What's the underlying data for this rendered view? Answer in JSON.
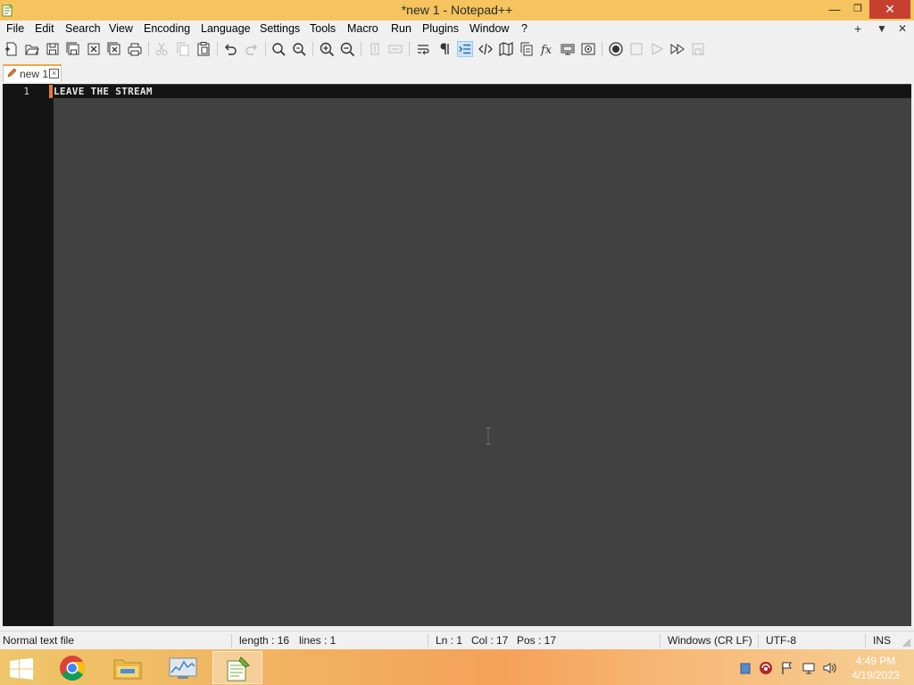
{
  "window": {
    "title": "*new 1 - Notepad++",
    "controls": {
      "minimize": "—",
      "maximize": "❐",
      "close": "✕"
    }
  },
  "menubar": {
    "items": [
      "File",
      "Edit",
      "Search",
      "View",
      "Encoding",
      "Language",
      "Settings",
      "Tools",
      "Macro",
      "Run",
      "Plugins",
      "Window",
      "?"
    ],
    "right": {
      "add": "+",
      "dropdown": "▼",
      "close": "✕"
    }
  },
  "toolbar": {
    "icons": [
      "new-file",
      "open-file",
      "save",
      "save-all",
      "close",
      "close-all",
      "print",
      "cut",
      "copy",
      "paste",
      "undo",
      "redo",
      "find",
      "replace",
      "zoom-in",
      "zoom-out",
      "sync-vertical",
      "sync-horizontal",
      "word-wrap",
      "show-all-characters",
      "indent-guide",
      "xml-tag",
      "document-map",
      "document-list",
      "function-list",
      "folder-as-workspace",
      "monitoring",
      "record-macro",
      "stop-recording",
      "play-macro",
      "run-macro-multiple",
      "save-macro"
    ]
  },
  "tabs": [
    {
      "label": "new 1",
      "active": true,
      "modified": true
    }
  ],
  "editor": {
    "lines": [
      {
        "number": "1",
        "text": "LEAVE THE STREAM"
      }
    ],
    "colors": {
      "background": "#414141",
      "gutter": "#141414",
      "text": "#e6e6e6",
      "change_marker": "#ea7a2b"
    }
  },
  "statusbar": {
    "file_type": "Normal text file",
    "length": "length : 16",
    "lines": "lines : 1",
    "ln": "Ln : 1",
    "col": "Col : 17",
    "pos": "Pos : 17",
    "eol": "Windows (CR LF)",
    "encoding": "UTF-8",
    "mode": "INS"
  },
  "taskbar": {
    "apps": [
      "start",
      "chrome",
      "file-explorer",
      "resource-monitor",
      "notepad-plus-plus"
    ],
    "tray_icons": [
      "notification-flag",
      "antivirus-icon",
      "action-center-flag",
      "network-icon",
      "volume-icon"
    ],
    "clock_time": "4:49 PM",
    "clock_date": "4/19/2023"
  }
}
